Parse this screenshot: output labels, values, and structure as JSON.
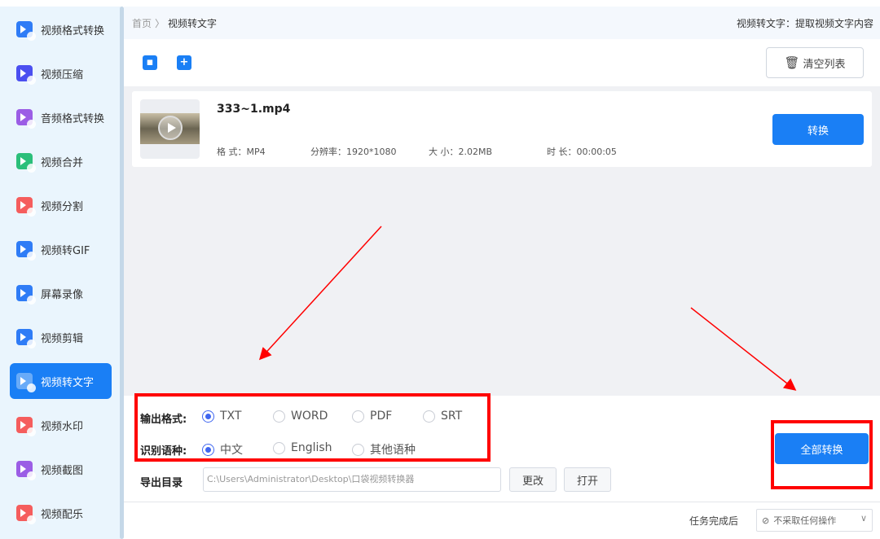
{
  "sidebar": {
    "items": [
      {
        "label": "视频格式转换",
        "color": "#2f7cf6"
      },
      {
        "label": "视频压缩",
        "color": "#4b4ff0"
      },
      {
        "label": "音频格式转换",
        "color": "#9b5de5"
      },
      {
        "label": "视频合并",
        "color": "#2bbf7a"
      },
      {
        "label": "视频分割",
        "color": "#f55d5d"
      },
      {
        "label": "视频转GIF",
        "color": "#2f7cf6"
      },
      {
        "label": "屏幕录像",
        "color": "#2f7cf6"
      },
      {
        "label": "视频剪辑",
        "color": "#2f7cf6"
      },
      {
        "label": "视频转文字",
        "color": "#ffffff",
        "active": true
      },
      {
        "label": "视频水印",
        "color": "#f55d5d"
      },
      {
        "label": "视频截图",
        "color": "#9b5de5"
      },
      {
        "label": "视频配乐",
        "color": "#f55d5d"
      }
    ]
  },
  "header": {
    "home": "首页",
    "sep": "〉",
    "current": "视频转文字",
    "description": "视频转文字：提取视频文字内容"
  },
  "toolbar": {
    "clear_label": "清空列表"
  },
  "file": {
    "name": "333~1.mp4",
    "format": "格  式：MP4",
    "resolution": "分辨率：1920*1080",
    "size": "大  小：2.02MB",
    "duration": "时  长：00:00:05",
    "convert_label": "转换"
  },
  "settings": {
    "format_label": "输出格式:",
    "formats": [
      "TXT",
      "WORD",
      "PDF",
      "SRT"
    ],
    "format_selected": "TXT",
    "lang_label": "识别语种:",
    "langs": [
      "中文",
      "English",
      "其他语种"
    ],
    "lang_selected": "中文",
    "dir_label": "导出目录",
    "dir_value": "C:\\Users\\Administrator\\Desktop\\口袋视频转换器",
    "change_label": "更改",
    "open_label": "打开"
  },
  "convert_all_label": "全部转换",
  "footer": {
    "after_label": "任务完成后",
    "after_value": "不采取任何操作"
  },
  "annotation_color": "#ff0000",
  "accent": "#1a7ff5"
}
